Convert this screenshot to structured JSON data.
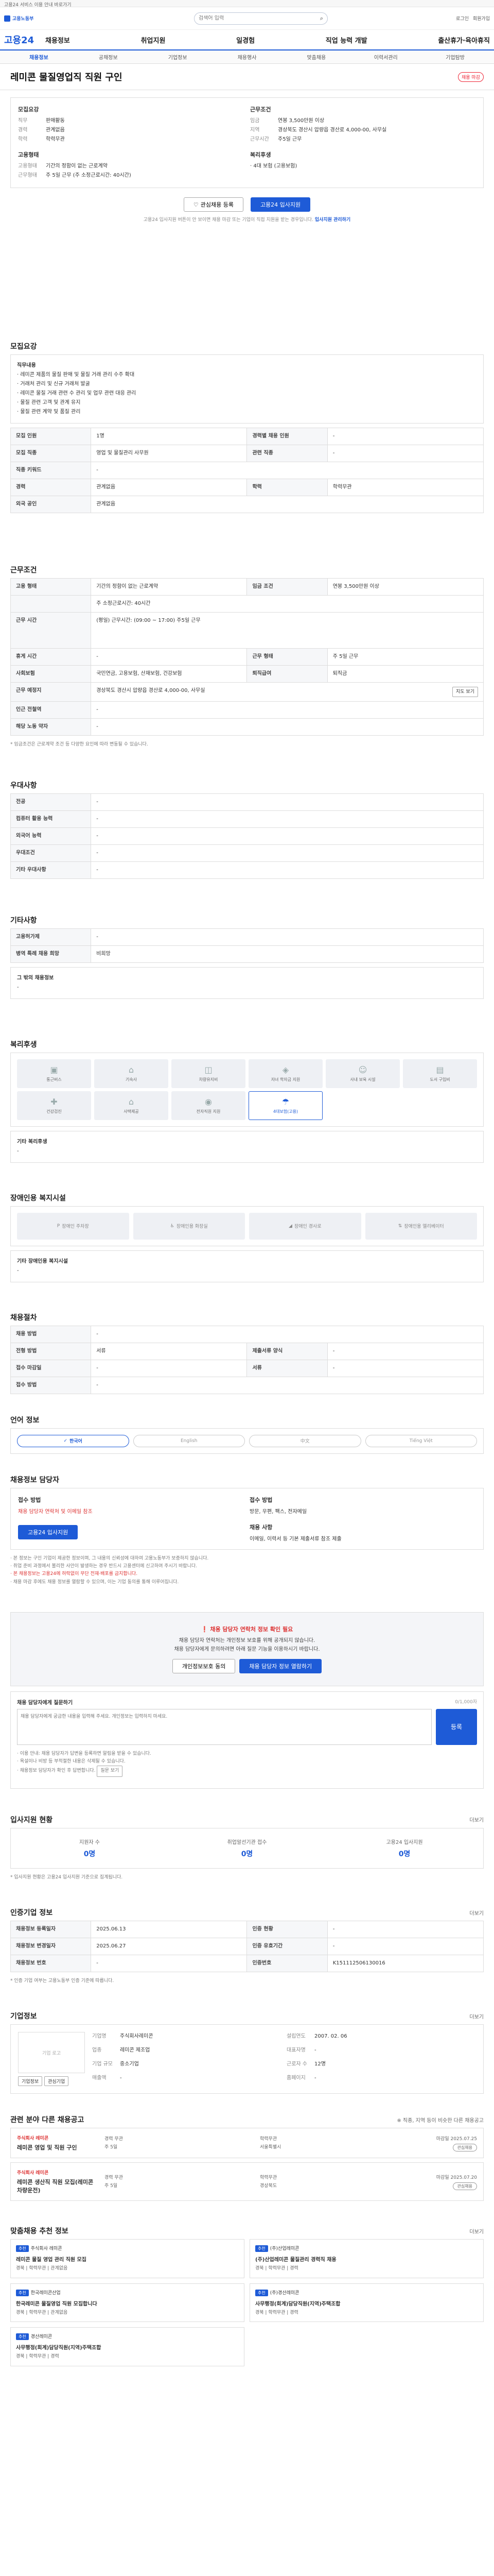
{
  "util": {
    "text": "고용24 서비스 이용 안내 바로가기"
  },
  "header": {
    "logo_text": "고용노동부",
    "search_placeholder": "검색어 입력",
    "links": [
      "로그인",
      "회원가입"
    ],
    "brand": "고용24",
    "nav": [
      "채용정보",
      "취업지원",
      "일경험",
      "직업 능력 개발",
      "출산휴가·육아휴직"
    ]
  },
  "subnav": [
    "채용정보",
    "공채정보",
    "기업정보",
    "채용행사",
    "맞춤채용",
    "이력서관리",
    "기업탐방"
  ],
  "job": {
    "title": "레미콘 물질영업직 직원 구인",
    "badge": "채용 마감",
    "left_h": "모집요강",
    "right_h": "근무조건",
    "left": [
      {
        "k": "직무",
        "v": "판매활동"
      },
      {
        "k": "경력",
        "v": "관계없음"
      },
      {
        "k": "학력",
        "v": "학력무관"
      }
    ],
    "right": [
      {
        "k": "임금",
        "v": "연봉 3,500만원 이상"
      },
      {
        "k": "지역",
        "v": "경상북도 경산시 압량읍 경산로 4,000-00, 사무실"
      },
      {
        "k": "근무시간",
        "v": "주5일 근무"
      }
    ],
    "left2_h": "고용형태",
    "left2": [
      {
        "k": "고용형태",
        "v": "기간의 정함이 없는 근로계약"
      },
      {
        "k": "근무형태",
        "v": "주 5일 근무 (주 소정근로시간: 40시간)"
      }
    ],
    "right2_h": "복리후생",
    "right2": [
      {
        "k": "",
        "v": "· 4대 보험 (고용보험)"
      }
    ],
    "btn_scrap": "관심채용 등록",
    "btn_apply": "고용24 입사지원",
    "notice": "고용24 입사지원 버튼이 안 보이면 채용 마감 또는 기업이 직접 지원을 받는 경우입니다.",
    "notice_link": "입사지원 관리하기"
  },
  "recruit": {
    "title": "모집요강",
    "duties_label": "직무내용",
    "duties": [
      "· 레미콘 제품의 물질 판매 및 물질 거래 관리 수주 확대",
      "· 거래처 관리 및 신규 거래처 발굴",
      "· 레미콘 물질 거래 관련 수 관리 및 업무 관련 대응 관리",
      "· 물질 관련 고객 및 관계 유지",
      "· 물질 관련 계약 및 품질 관리"
    ],
    "rows": [
      {
        "k1": "모집 인원",
        "v1": "1명",
        "k2": "경력별 채용 인원",
        "v2": "-"
      },
      {
        "k1": "모집 직종",
        "v1": "영업 및 물질관리 사무원",
        "k2": "관련 직종",
        "v2": "-"
      },
      {
        "k1": "직종 키워드",
        "v1": "-",
        "k2": "",
        "v2": ""
      },
      {
        "k1": "경력",
        "v1": "관계없음",
        "k2": "학력",
        "v2": "학력무관"
      },
      {
        "k1": "외국 공인",
        "v1": "관계없음",
        "k2": "",
        "v2": ""
      }
    ]
  },
  "work": {
    "title": "근무조건",
    "rows": [
      {
        "k1": "고용 형태",
        "v1": "기간의 정함이 없는 근로계약",
        "k2": "임금 조건",
        "v2": "연봉 3,500만원 이상"
      },
      {
        "k1": "",
        "v1": "주 소정근로시간: 40시간",
        "k2": "",
        "v2": ""
      },
      {
        "k1": "근무 시간",
        "v1": "(평일) 근무시간: (09:00 ~ 17:00) 주5일 근무",
        "k2": "",
        "v2": ""
      },
      {
        "k1": "휴게 시간",
        "v1": "-",
        "k2": "근무 형태",
        "v2": "주 5일 근무"
      },
      {
        "k1": "사회보험",
        "v1": "국민연금, 고용보험, 산재보험, 건강보험",
        "k2": "퇴직급여",
        "v2": "퇴직금"
      },
      {
        "k1": "근무 예정지",
        "v1": "경상북도 경산시 압량읍 경산로 4,000-00, 사무실",
        "k2": "",
        "v2": ""
      },
      {
        "k1": "인근 전철역",
        "v1": "-",
        "k2": "",
        "v2": ""
      },
      {
        "k1": "해당 노동 약자",
        "v1": "-",
        "k2": "",
        "v2": ""
      }
    ],
    "map_btn": "지도 보기",
    "note": "* 임금조건은 근로계약 조건 등 다양한 요인에 따라 변동될 수 있습니다."
  },
  "prefer": {
    "title": "우대사항",
    "rows": [
      {
        "k": "전공",
        "v": "-"
      },
      {
        "k": "컴퓨터 활용 능력",
        "v": "-"
      },
      {
        "k": "외국어 능력",
        "v": "-"
      },
      {
        "k": "우대조건",
        "v": "-"
      },
      {
        "k": "기타 우대사항",
        "v": "-"
      }
    ]
  },
  "etc": {
    "title": "기타사항",
    "rows": [
      {
        "k": "고용허가제",
        "v": "-"
      },
      {
        "k": "병역 특례 채용 희망",
        "v": "비희망"
      }
    ],
    "extra_label": "그 밖의 채용정보",
    "extra": "-"
  },
  "welfare": {
    "title": "복리후생",
    "items": [
      {
        "label": "통근버스",
        "on": false
      },
      {
        "label": "기숙사",
        "on": false
      },
      {
        "label": "차량유지비",
        "on": false
      },
      {
        "label": "자녀 학자금 지원",
        "on": false
      },
      {
        "label": "사내 보육 시설",
        "on": false
      },
      {
        "label": "도서 구입비",
        "on": false
      },
      {
        "label": "건강검진",
        "on": false
      },
      {
        "label": "사택제공",
        "on": false
      },
      {
        "label": "전자직원 지원",
        "on": false
      },
      {
        "label": "4대보험(고용)",
        "on": true
      }
    ],
    "etc_label": "기타 복리후생",
    "etc": "-"
  },
  "disabled": {
    "title": "장애인용 복지시설",
    "items": [
      "장애인 주차장",
      "장애인용 화장실",
      "장애인 경사로",
      "장애인용 엘리베이터"
    ],
    "etc_label": "기타 장애인용 복지시설",
    "etc": "-"
  },
  "process": {
    "title": "채용절차",
    "rows": [
      {
        "k1": "채용 방법",
        "v1": "-",
        "k2": "",
        "v2": ""
      },
      {
        "k1": "전형 방법",
        "v1": "서류",
        "k2": "제출서류 양식",
        "v2": "-"
      },
      {
        "k1": "접수 마감일",
        "v1": "-",
        "k2": "서류",
        "v2": "-"
      },
      {
        "k1": "접수 방법",
        "v1": "-",
        "k2": "",
        "v2": ""
      }
    ]
  },
  "language": {
    "title": "언어 정보",
    "items": [
      {
        "label": "한국어",
        "on": true
      },
      {
        "label": "English",
        "on": false
      },
      {
        "label": "中文",
        "on": false
      },
      {
        "label": "Tiếng Việt",
        "on": false
      }
    ]
  },
  "contact": {
    "title": "채용정보 담당자",
    "left_h": "접수 방법",
    "left_v": "채용 담당자 연락처 및 이메일 참조",
    "apply_btn": "고용24 입사지원",
    "right_h": "접수 방법",
    "right_v": "방문, 우편, 팩스, 전자메일",
    "person_h": "채용 사항",
    "person_v": "이메일, 이력서 등 기본 제출서류 참조 제출"
  },
  "notes": [
    "· 본 정보는 구인 기업이 제공한 정보이며, 그 내용의 신뢰성에 대하여 고용노동부가 보증하지 않습니다.",
    "· 취업 준비 과정에서 불리한 사안이 발생하는 경우 반드시 고용센터에 신고하여 주시기 바랍니다.",
    "· 본 채용정보는 고용24에 허락없이 무단 전재·배포를 금지합니다.",
    "· 채용 마감 후에도 채용 정보를 열람할 수 있으며, 이는 기업 동의를 통해 이루어집니다."
  ],
  "warn": {
    "title": "채용 담당자 연락처 정보 확인 필요",
    "text1": "채용 담당자 연락처는 개인정보 보호를 위해 공개되지 않습니다.",
    "text2": "채용 담당자에게 문의하려면 아래 질문 기능을 이용하시기 바랍니다.",
    "btn1": "개인정보보호 동의",
    "btn2": "채용 담당자 정보 열람하기"
  },
  "qna": {
    "title": "채용 담당자에게 질문하기",
    "count": "0/1,000자",
    "placeholder": "채용 담당자에게 궁금한 내용을 입력해 주세요. 개인정보는 입력하지 마세요.",
    "submit": "등록",
    "notes": [
      "· 이용 안내: 채용 담당자가 답변을 등록하면 알림을 받을 수 있습니다.",
      "· 욕설이나 비방 등 부적절한 내용은 삭제될 수 있습니다.",
      "· 채용정보 담당자가 확인 후 답변합니다."
    ],
    "view_btn": "질문 보기"
  },
  "stats": {
    "title": "입사지원 현황",
    "more": "더보기",
    "items": [
      {
        "k": "지원자 수",
        "v": "0명"
      },
      {
        "k": "취업알선기관 접수",
        "v": "0명"
      },
      {
        "k": "고용24 입사지원",
        "v": "0명"
      }
    ],
    "note": "* 입사지원 현황은 고용24 입사지원 기준으로 집계됩니다."
  },
  "info": {
    "title": "인증기업 정보",
    "more": "더보기",
    "rows": [
      {
        "k1": "채용정보 등록일자",
        "v1": "2025.06.13",
        "k2": "인증 현황",
        "v2": "-"
      },
      {
        "k1": "채용정보 변경일자",
        "v1": "2025.06.27",
        "k2": "인증 유효기간",
        "v2": "-"
      },
      {
        "k1": "채용정보 번호",
        "v1": "-",
        "k2": "인증번호",
        "v2": "K151112506130016"
      }
    ],
    "note": "* 인증 기업 여부는 고용노동부 인증 기준에 따릅니다."
  },
  "company": {
    "title": "기업정보",
    "more": "더보기",
    "logo_alt": "기업 로고",
    "logo_btns": [
      "기업정보",
      "관심기업"
    ],
    "rows": [
      {
        "k": "기업명",
        "v": "주식회사레미콘"
      },
      {
        "k": "업종",
        "v": "레미콘 제조업"
      },
      {
        "k": "기업 규모",
        "v": "중소기업"
      },
      {
        "k": "설립연도",
        "v": "2007. 02. 06"
      },
      {
        "k": "대표자명",
        "v": "-"
      },
      {
        "k": "근로자 수",
        "v": "12명"
      },
      {
        "k": "매출액",
        "v": "-"
      },
      {
        "k": "홈페이지",
        "v": "-"
      }
    ]
  },
  "similar": {
    "title": "관련 분야 다른 채용공고",
    "note": "※ 직종, 지역 등이 비슷한 다른 채용공고",
    "items": [
      {
        "co": "주식회사 레미콘",
        "title": "레미콘 영업 및 직원 구인",
        "meta": [
          "경력 무관",
          "학력무관",
          "주 5일",
          "서울특별시"
        ],
        "deadline": "마감일 2025.07.25",
        "pill": "관심채용"
      },
      {
        "co": "주식회사 레미콘",
        "title": "레미콘 생산직 직원 모집(레미콘 차량운전)",
        "meta": [
          "경력 무관",
          "학력무관",
          "주 5일",
          "경상북도"
        ],
        "deadline": "마감일 2025.07.20",
        "pill": "관심채용"
      }
    ]
  },
  "recommend": {
    "title": "맞춤채용 추천 정보",
    "more": "더보기",
    "items": [
      {
        "tag": "추천",
        "co": "주식회사 레미콘",
        "title": "레미콘 물질 영업 관리 직원 모집",
        "meta": "경북 | 학력무관 | 관계없음"
      },
      {
        "tag": "추천",
        "co": "(주)산업레미콘",
        "title": "(주)산업레미콘 물질관리 경력직 채용",
        "meta": "경북 | 학력무관 | 경력"
      },
      {
        "tag": "추천",
        "co": "한국레미콘산업",
        "title": "한국레미콘 물질영업 직원 모집합니다",
        "meta": "경북 | 학력무관 | 관계없음"
      },
      {
        "tag": "추천",
        "co": "(주)경산레미콘",
        "title": "사무행정(회계)담당직원(지역)주택조합",
        "meta": "경북 | 학력무관 | 경력"
      },
      {
        "tag": "추천",
        "co": "경산레미콘",
        "title": "사무행정(회계)담당직원(지역)주택조합",
        "meta": "경북 | 학력무관 | 경력"
      }
    ]
  }
}
